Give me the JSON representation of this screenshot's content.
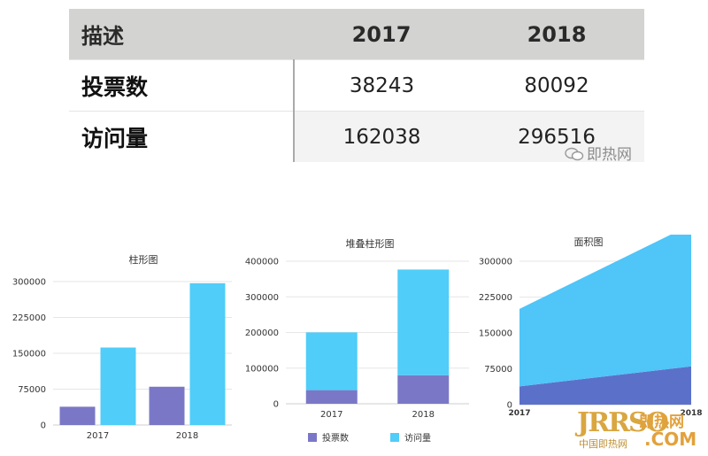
{
  "table": {
    "headers": [
      "描述",
      "2017",
      "2018"
    ],
    "rows": [
      {
        "label": "投票数",
        "values": [
          "38243",
          "80092"
        ]
      },
      {
        "label": "访问量",
        "values": [
          "162038",
          "296516"
        ]
      }
    ]
  },
  "watermarks": {
    "top": "即热网",
    "bottom_logo": "JRRSO",
    "bottom_site": "即热网",
    "bottom_sub": "中国即热网",
    "bottom_com": ".COM"
  },
  "colors": {
    "votes": "#7a78c6",
    "visits": "#50cdf8",
    "area_votes": "#5b71c9",
    "area_visits": "#4fc5f8",
    "grid": "#e6e6e6",
    "header_bg": "#d3d3d1"
  },
  "chart_data": [
    {
      "type": "bar",
      "title": "柱形图",
      "categories": [
        "2017",
        "2018"
      ],
      "series": [
        {
          "name": "投票数",
          "values": [
            38243,
            80092
          ]
        },
        {
          "name": "访问量",
          "values": [
            162038,
            296516
          ]
        }
      ],
      "yticks": [
        "0",
        "75000",
        "150000",
        "225000",
        "300000"
      ],
      "ylim": [
        0,
        300000
      ],
      "grid": true
    },
    {
      "type": "bar",
      "stacked": true,
      "title": "堆叠柱形图",
      "categories": [
        "2017",
        "2018"
      ],
      "series": [
        {
          "name": "投票数",
          "values": [
            38243,
            80092
          ]
        },
        {
          "name": "访问量",
          "values": [
            162038,
            296516
          ]
        }
      ],
      "yticks": [
        "0",
        "100000",
        "200000",
        "300000",
        "400000"
      ],
      "ylim": [
        0,
        400000
      ],
      "legend": "bottom",
      "grid": true
    },
    {
      "type": "area",
      "stacked": true,
      "title": "面积图",
      "categories": [
        "2017",
        "2018"
      ],
      "series": [
        {
          "name": "投票数",
          "values": [
            38243,
            80092
          ]
        },
        {
          "name": "访问量",
          "values": [
            162038,
            296516
          ]
        }
      ],
      "yticks": [
        "0",
        "75000",
        "150000",
        "225000",
        "300000"
      ],
      "ylim": [
        0,
        300000
      ],
      "grid": true
    }
  ]
}
